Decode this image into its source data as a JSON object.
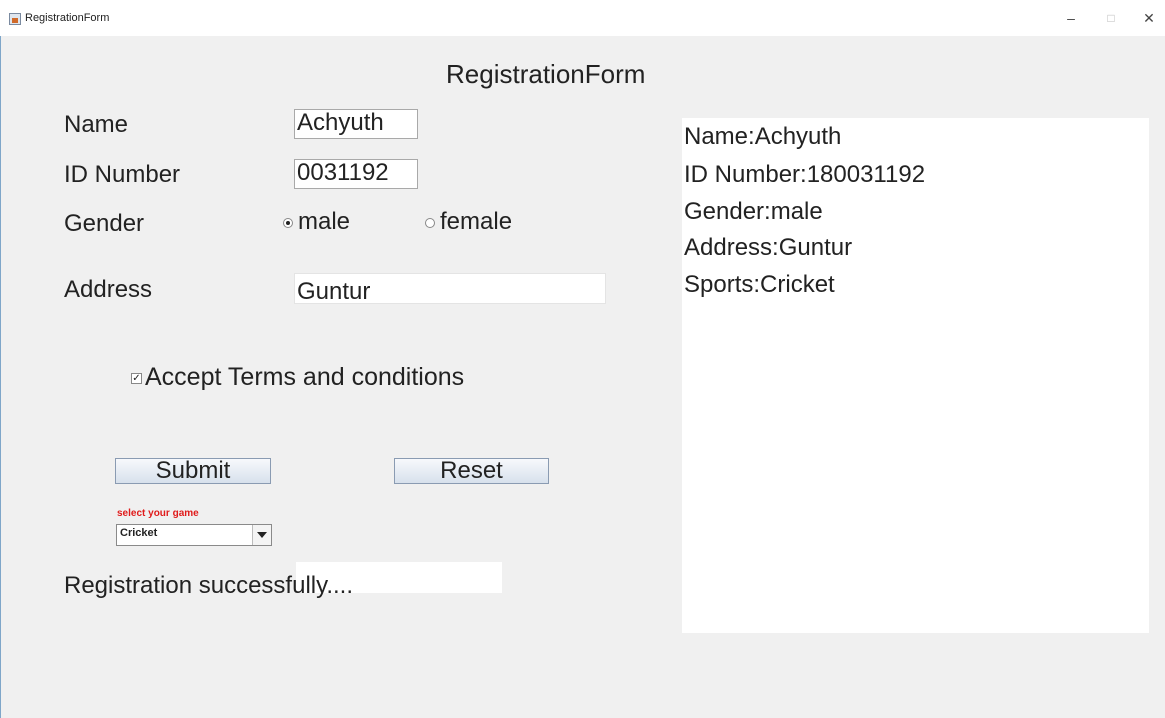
{
  "window": {
    "title": "RegistrationForm",
    "minimize": "–",
    "maximize": "□",
    "close": "✕"
  },
  "form": {
    "heading": "RegistrationForm",
    "name_label": "Name",
    "name_value": "Achyuth",
    "id_label": "ID Number",
    "id_value": "0031192",
    "gender_label": "Gender",
    "gender_male": "male",
    "gender_female": "female",
    "gender_selected": "male",
    "address_label": "Address",
    "address_value": "Guntur",
    "terms_label": "Accept Terms and conditions",
    "terms_checked": true,
    "submit_label": "Submit",
    "reset_label": "Reset",
    "game_label": "select your game",
    "game_value": "Cricket",
    "status_text": "Registration successfully...."
  },
  "output": {
    "lines": [
      "Name:Achyuth",
      "ID Number:180031192",
      "Gender:male",
      "Address:Guntur",
      "Sports:Cricket"
    ]
  }
}
